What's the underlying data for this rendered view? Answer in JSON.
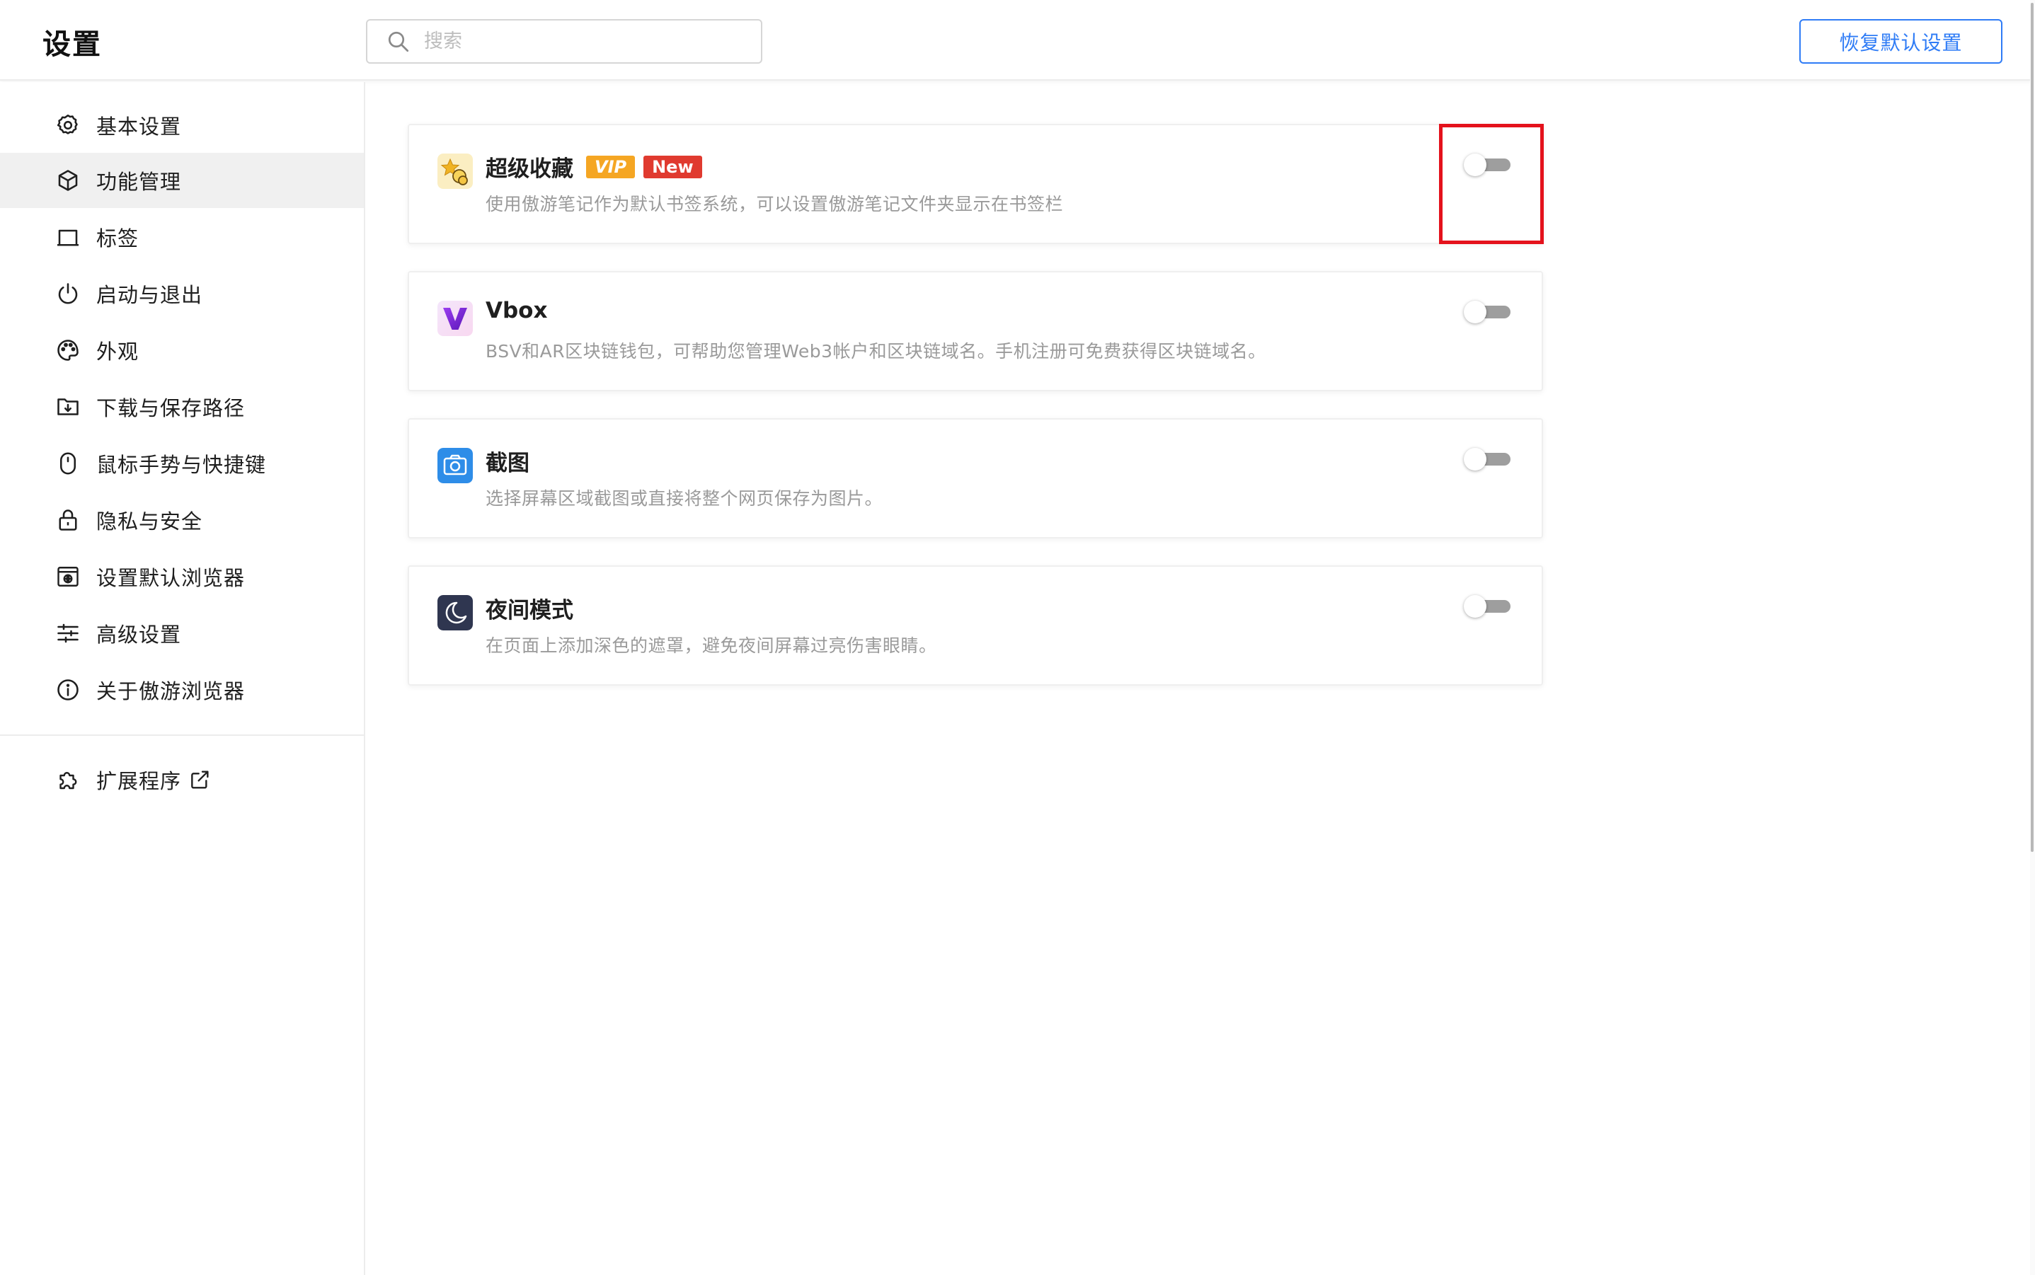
{
  "header": {
    "title": "设置",
    "search_placeholder": "搜索",
    "search_value": "",
    "restore_button": "恢复默认设置"
  },
  "sidebar": {
    "items": [
      {
        "label": "基本设置",
        "icon": "gear-icon",
        "active": false
      },
      {
        "label": "功能管理",
        "icon": "cube-icon",
        "active": true
      },
      {
        "label": "标签",
        "icon": "tab-icon",
        "active": false
      },
      {
        "label": "启动与退出",
        "icon": "power-icon",
        "active": false
      },
      {
        "label": "外观",
        "icon": "palette-icon",
        "active": false
      },
      {
        "label": "下载与保存路径",
        "icon": "folder-download-icon",
        "active": false
      },
      {
        "label": "鼠标手势与快捷键",
        "icon": "mouse-icon",
        "active": false
      },
      {
        "label": "隐私与安全",
        "icon": "lock-icon",
        "active": false
      },
      {
        "label": "设置默认浏览器",
        "icon": "browser-window-icon",
        "active": false
      },
      {
        "label": "高级设置",
        "icon": "sliders-icon",
        "active": false
      },
      {
        "label": "关于傲游浏览器",
        "icon": "info-icon",
        "active": false
      }
    ],
    "extensions": {
      "label": "扩展程序",
      "icon": "puzzle-icon",
      "link_icon": "external-link-icon"
    }
  },
  "features": [
    {
      "title": "超级收藏",
      "badges": [
        "VIP",
        "New"
      ],
      "description": "使用傲游笔记作为默认书签系统，可以设置傲游笔记文件夹显示在书签栏",
      "icon": "super-favorites-icon",
      "enabled": false
    },
    {
      "title": "Vbox",
      "badges": [],
      "description": "BSV和AR区块链钱包，可帮助您管理Web3帐户和区块链域名。手机注册可免费获得区块链域名。",
      "icon": "vbox-icon",
      "enabled": false
    },
    {
      "title": "截图",
      "badges": [],
      "description": "选择屏幕区域截图或直接将整个网页保存为图片。",
      "icon": "screenshot-icon",
      "enabled": false
    },
    {
      "title": "夜间模式",
      "badges": [],
      "description": "在页面上添加深色的遮罩，避免夜间屏幕过亮伤害眼睛。",
      "icon": "night-mode-icon",
      "enabled": false
    }
  ],
  "colors": {
    "accent": "#2f7cf6",
    "vip_badge": "#f5a623",
    "new_badge": "#e03a2f",
    "highlight": "#e4121c",
    "active_nav_bg": "#f0f0f0"
  }
}
